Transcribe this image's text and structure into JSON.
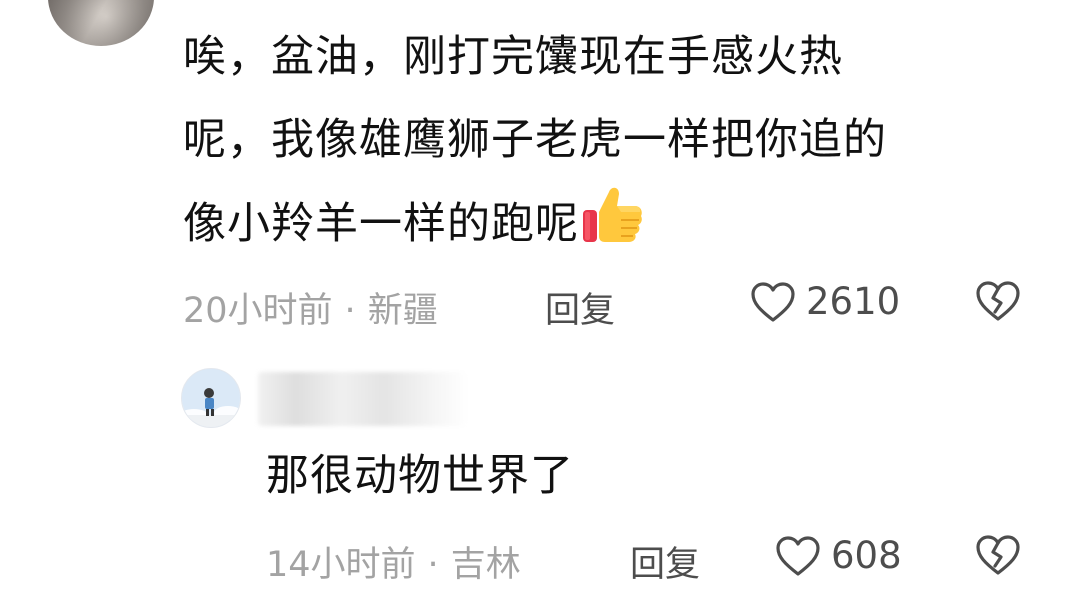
{
  "comment": {
    "text_lines": [
      "唉，盆油，刚打完馕现在手感火热",
      "呢，我像雄鹰狮子老虎一样把你追的",
      "像小羚羊一样的跑呢"
    ],
    "emoji": "thumbs-up-icon",
    "time": "20小时前",
    "separator": "·",
    "location": "新疆",
    "reply_label": "回复",
    "like_count": "2610"
  },
  "reply": {
    "text": "那很动物世界了",
    "time": "14小时前",
    "separator": "·",
    "location": "吉林",
    "reply_label": "回复",
    "like_count": "608"
  },
  "colors": {
    "text": "#111111",
    "meta": "#a3a3a3",
    "action": "#4d4d4d",
    "thumb_yellow": "#ffc83d",
    "thumb_red": "#e8354a"
  }
}
